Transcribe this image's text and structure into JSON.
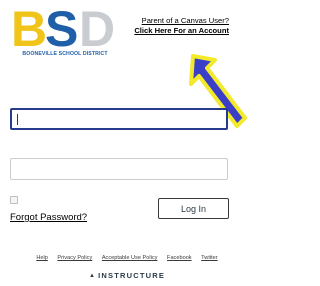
{
  "logo": {
    "letters": "BSD",
    "caption": "BOONEVILLE SCHOOL DISTRICT",
    "colors": {
      "b": "#f0c419",
      "s": "#1f5fa8",
      "d": "#c9ccd0"
    }
  },
  "parent_prompt": {
    "question": "Parent of a Canvas User?",
    "link_label": "Click Here For an Account"
  },
  "annotation": {
    "arrow_fill": "#3b3fc8",
    "arrow_outline": "#f2ea2a"
  },
  "login_form": {
    "username_value": "",
    "password_value": "",
    "remember_checked": false,
    "forgot_label": "Forgot Password?",
    "login_label": "Log In",
    "focus_color": "#283a8e"
  },
  "footer": {
    "links": [
      "Help",
      "Privacy Policy",
      "Acceptable Use Policy",
      "Facebook",
      "Twitter"
    ],
    "brand": "INSTRUCTURE"
  }
}
